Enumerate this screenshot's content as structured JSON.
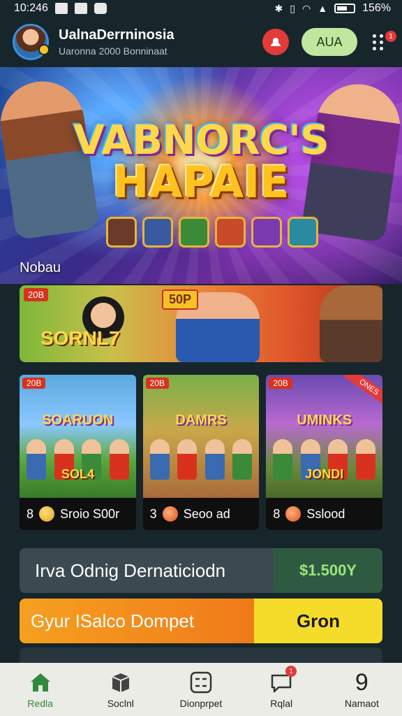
{
  "status_bar": {
    "time": "10:246",
    "battery": "156%"
  },
  "header": {
    "title": "UalnaDerrninosia",
    "subtitle": "Uaronna 2000 Bonninaat",
    "add_label": "AUA",
    "menu_badge": "1"
  },
  "hero": {
    "title_line1": "VABNORC'S",
    "title_line2": "HAPAIE",
    "label": "Nobau"
  },
  "banner": {
    "badge": "20B",
    "price": "50P",
    "title": "SORNL7"
  },
  "cards": [
    {
      "badge": "20B",
      "title": "SOARUON",
      "subtitle": "SOL4",
      "count": "8",
      "label": "Sroio S00r",
      "coin": "gold"
    },
    {
      "badge": "20B",
      "title": "DAMRS",
      "subtitle": "",
      "count": "3",
      "label": "Seoo ad",
      "coin": "orange"
    },
    {
      "badge": "20B",
      "title": "UMINKS",
      "subtitle": "JONDI",
      "ribbon": "ONES",
      "count": "8",
      "label": "Sslood",
      "coin": "orange"
    }
  ],
  "bar_info": {
    "label": "Irva Odnig Dernaticiodn",
    "value": "$1.500Y"
  },
  "bar_action": {
    "label": "Gyur ISalco Dompet",
    "value": "Gron"
  },
  "bottom_nav": [
    {
      "label": "Redla",
      "icon": "home-icon",
      "active": true
    },
    {
      "label": "Soclnl",
      "icon": "box-icon",
      "active": false
    },
    {
      "label": "Dionprpet",
      "icon": "calculator-icon",
      "active": false
    },
    {
      "label": "Rqlal",
      "icon": "chat-icon",
      "active": false,
      "badge": "1"
    },
    {
      "label": "Namaot",
      "icon": "number-icon",
      "active": false,
      "glyph": "9"
    }
  ],
  "colors": {
    "background": "#17262b",
    "accent_green": "#2f8a3a",
    "accent_red": "#e33a3a",
    "accent_yellow": "#f6dc2a"
  }
}
